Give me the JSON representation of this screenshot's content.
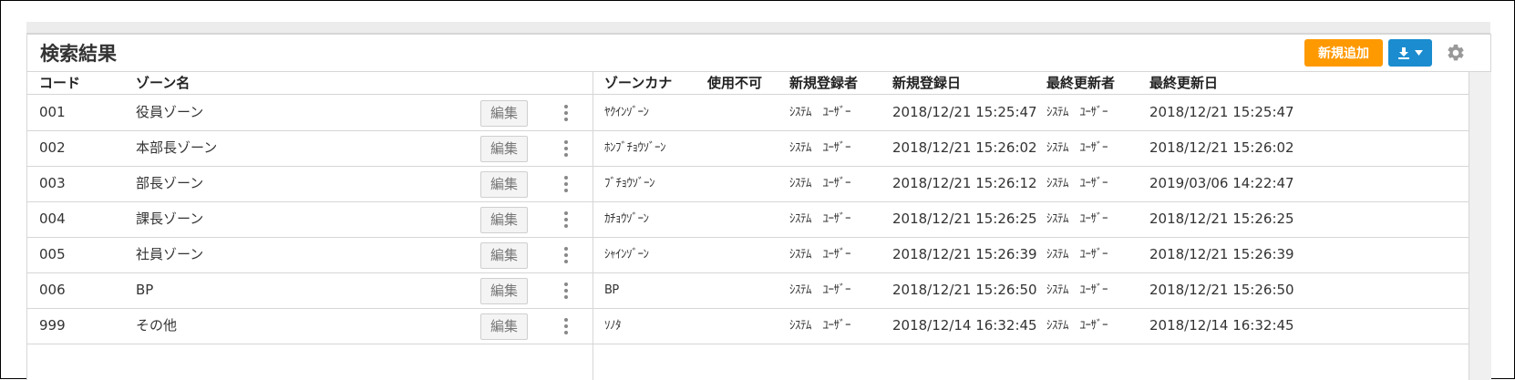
{
  "panel": {
    "title": "検索結果",
    "add_button": "新規追加",
    "download_icon": "download-icon",
    "settings_icon": "gear-icon",
    "accent_orange": "#ff9900",
    "accent_blue": "#1a8ccf"
  },
  "table": {
    "headers": {
      "code": "コード",
      "zone_name": "ゾーン名",
      "zone_kana": "ゾーンカナ",
      "disabled": "使用不可",
      "created_by": "新規登録者",
      "created_at": "新規登録日",
      "updated_by": "最終更新者",
      "updated_at": "最終更新日"
    },
    "edit_label": "編集",
    "rows": [
      {
        "code": "001",
        "name": "役員ゾーン",
        "kana": "ﾔｸｲﾝｿﾞｰﾝ",
        "disabled": "",
        "created_by": "ｼｽﾃﾑ　ﾕｰｻﾞｰ",
        "created_at": "2018/12/21 15:25:47",
        "updated_by": "ｼｽﾃﾑ　ﾕｰｻﾞｰ",
        "updated_at": "2018/12/21 15:25:47"
      },
      {
        "code": "002",
        "name": "本部長ゾーン",
        "kana": "ﾎﾝﾌﾞﾁｮｳｿﾞｰﾝ",
        "disabled": "",
        "created_by": "ｼｽﾃﾑ　ﾕｰｻﾞｰ",
        "created_at": "2018/12/21 15:26:02",
        "updated_by": "ｼｽﾃﾑ　ﾕｰｻﾞｰ",
        "updated_at": "2018/12/21 15:26:02"
      },
      {
        "code": "003",
        "name": "部長ゾーン",
        "kana": "ﾌﾞﾁｮｳｿﾞｰﾝ",
        "disabled": "",
        "created_by": "ｼｽﾃﾑ　ﾕｰｻﾞｰ",
        "created_at": "2018/12/21 15:26:12",
        "updated_by": "ｼｽﾃﾑ　ﾕｰｻﾞｰ",
        "updated_at": "2019/03/06 14:22:47"
      },
      {
        "code": "004",
        "name": "課長ゾーン",
        "kana": "ｶﾁｮｳｿﾞｰﾝ",
        "disabled": "",
        "created_by": "ｼｽﾃﾑ　ﾕｰｻﾞｰ",
        "created_at": "2018/12/21 15:26:25",
        "updated_by": "ｼｽﾃﾑ　ﾕｰｻﾞｰ",
        "updated_at": "2018/12/21 15:26:25"
      },
      {
        "code": "005",
        "name": "社員ゾーン",
        "kana": "ｼｬｲﾝｿﾞｰﾝ",
        "disabled": "",
        "created_by": "ｼｽﾃﾑ　ﾕｰｻﾞｰ",
        "created_at": "2018/12/21 15:26:39",
        "updated_by": "ｼｽﾃﾑ　ﾕｰｻﾞｰ",
        "updated_at": "2018/12/21 15:26:39"
      },
      {
        "code": "006",
        "name": "BP",
        "kana": "BP",
        "disabled": "",
        "created_by": "ｼｽﾃﾑ　ﾕｰｻﾞｰ",
        "created_at": "2018/12/21 15:26:50",
        "updated_by": "ｼｽﾃﾑ　ﾕｰｻﾞｰ",
        "updated_at": "2018/12/21 15:26:50"
      },
      {
        "code": "999",
        "name": "その他",
        "kana": "ｿﾉﾀ",
        "disabled": "",
        "created_by": "ｼｽﾃﾑ　ﾕｰｻﾞｰ",
        "created_at": "2018/12/14 16:32:45",
        "updated_by": "ｼｽﾃﾑ　ﾕｰｻﾞｰ",
        "updated_at": "2018/12/14 16:32:45"
      }
    ]
  }
}
